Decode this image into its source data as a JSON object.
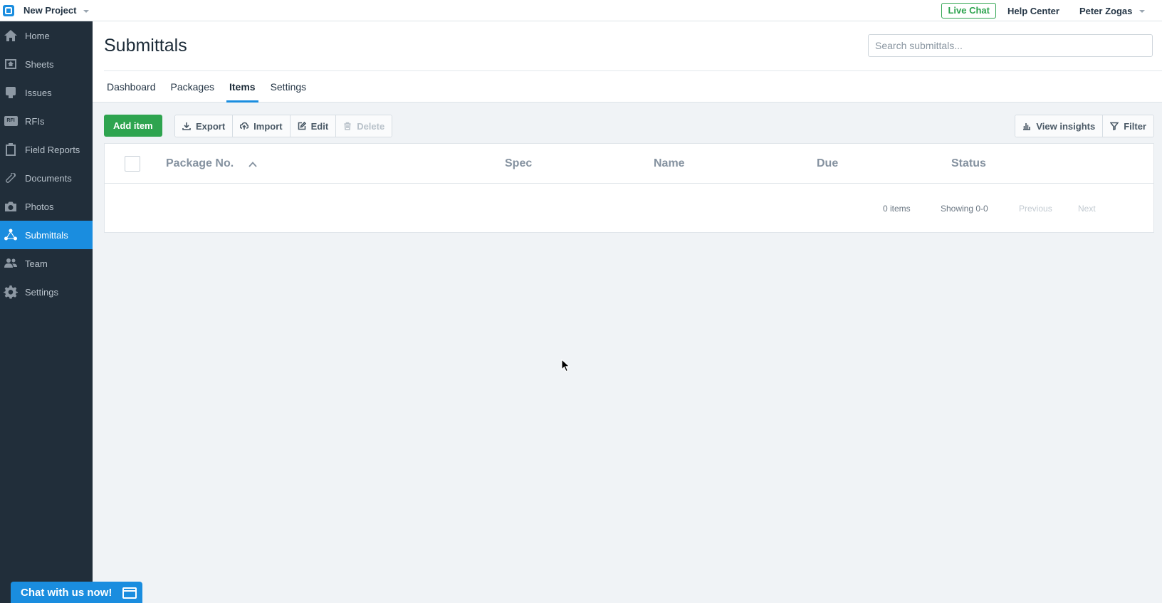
{
  "app": {
    "project_name": "New Project",
    "live_chat": "Live Chat",
    "help_center": "Help Center",
    "user_name": "Peter Zogas"
  },
  "sidebar": {
    "items": [
      {
        "label": "Home",
        "icon": "home-icon"
      },
      {
        "label": "Sheets",
        "icon": "sheets-icon"
      },
      {
        "label": "Issues",
        "icon": "issues-icon"
      },
      {
        "label": "RFIs",
        "icon": "rfi-icon",
        "badge": "RFI"
      },
      {
        "label": "Field Reports",
        "icon": "clipboard-icon"
      },
      {
        "label": "Documents",
        "icon": "paperclip-icon"
      },
      {
        "label": "Photos",
        "icon": "camera-icon"
      },
      {
        "label": "Submittals",
        "icon": "submittals-icon",
        "active": true
      },
      {
        "label": "Team",
        "icon": "team-icon"
      },
      {
        "label": "Settings",
        "icon": "gear-icon"
      }
    ]
  },
  "page": {
    "title": "Submittals",
    "search_placeholder": "Search submittals...",
    "tabs": [
      {
        "label": "Dashboard"
      },
      {
        "label": "Packages"
      },
      {
        "label": "Items",
        "active": true
      },
      {
        "label": "Settings"
      }
    ]
  },
  "toolbar": {
    "add_item": "Add item",
    "export": "Export",
    "import": "Import",
    "edit": "Edit",
    "delete": "Delete",
    "view_insights": "View insights",
    "filter": "Filter"
  },
  "table": {
    "columns": [
      "Package No.",
      "Spec",
      "Name",
      "Due",
      "Status"
    ],
    "sort_column": "Package No.",
    "sort_direction": "ascending",
    "rows": [],
    "item_count": "0 items",
    "showing": "Showing 0-0",
    "previous": "Previous",
    "next": "Next"
  },
  "chat_widget": {
    "label": "Chat with us now!"
  },
  "colors": {
    "brand_blue": "#1a8ddf",
    "sidebar_bg": "#212e3a",
    "success_green": "#2ea44f",
    "page_bg": "#f0f3f6"
  }
}
